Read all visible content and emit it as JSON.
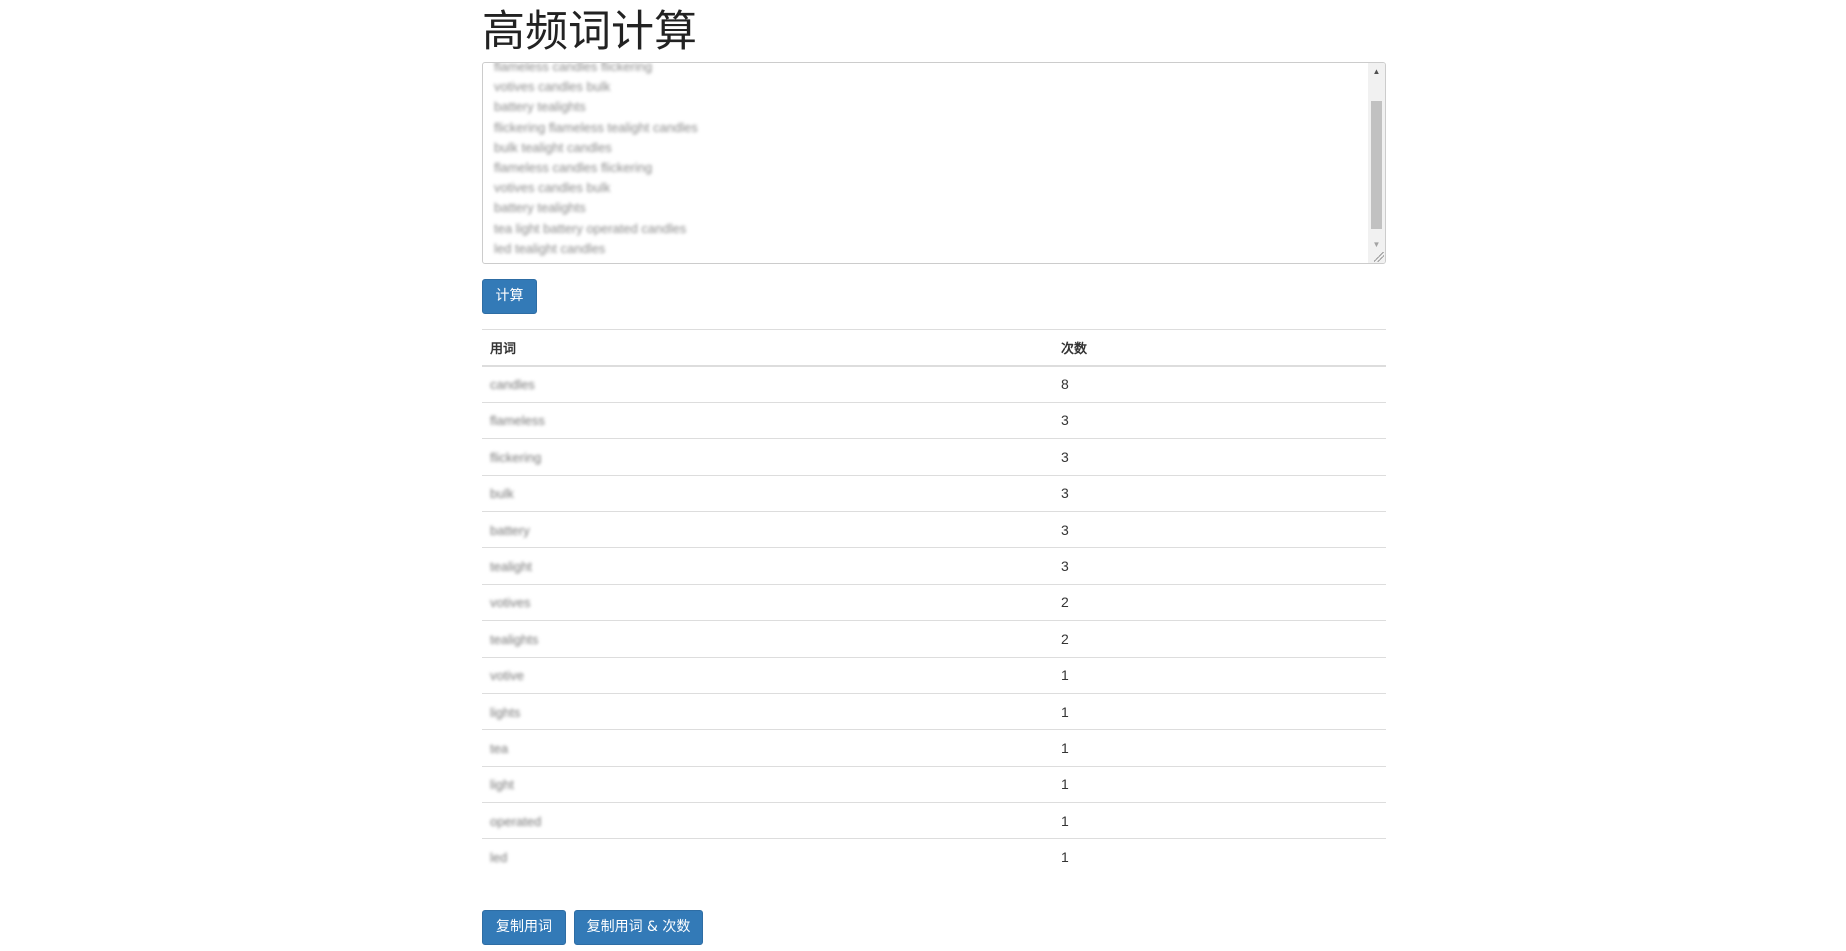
{
  "page": {
    "title": "高频词计算"
  },
  "input": {
    "lines": [
      "flameless candles flickering",
      "votives candles bulk",
      "battery tealights",
      "flickering flameless tealight candles",
      "bulk tealight candles",
      "flameless candles flickering",
      "votives candles bulk",
      "battery tealights",
      "tea light battery operated candles",
      "led tealight candles"
    ]
  },
  "buttons": {
    "calculate": "计算",
    "copy_words": "复制用词",
    "copy_words_counts": "复制用词 & 次数"
  },
  "table": {
    "headers": {
      "word": "用词",
      "count": "次数"
    },
    "rows": [
      {
        "word": "candles",
        "count": "8"
      },
      {
        "word": "flameless",
        "count": "3"
      },
      {
        "word": "flickering",
        "count": "3"
      },
      {
        "word": "bulk",
        "count": "3"
      },
      {
        "word": "battery",
        "count": "3"
      },
      {
        "word": "tealight",
        "count": "3"
      },
      {
        "word": "votives",
        "count": "2"
      },
      {
        "word": "tealights",
        "count": "2"
      },
      {
        "word": "votive",
        "count": "1"
      },
      {
        "word": "lights",
        "count": "1"
      },
      {
        "word": "tea",
        "count": "1"
      },
      {
        "word": "light",
        "count": "1"
      },
      {
        "word": "operated",
        "count": "1"
      },
      {
        "word": "led",
        "count": "1"
      }
    ]
  }
}
